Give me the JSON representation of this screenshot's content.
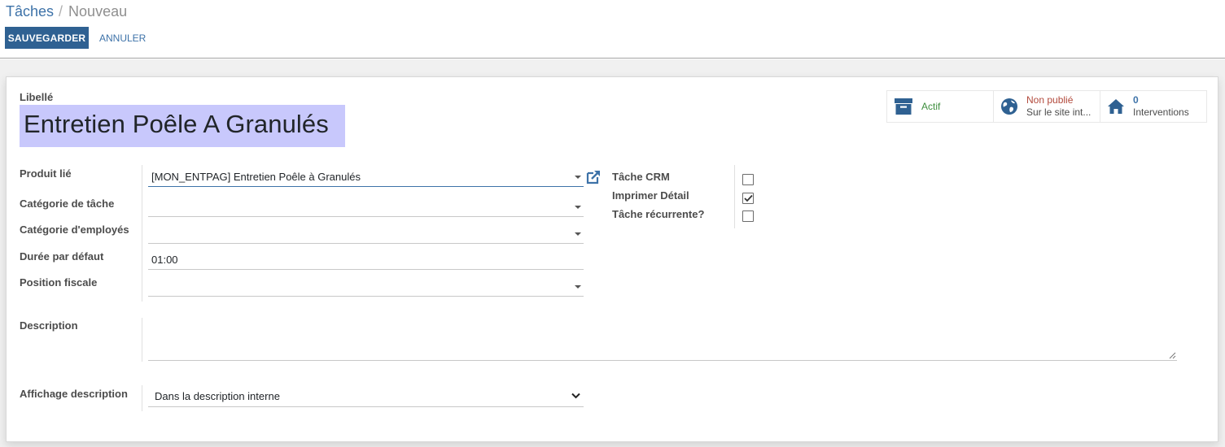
{
  "breadcrumb": {
    "parent": "Tâches",
    "separator": "/",
    "current": "Nouveau"
  },
  "buttons": {
    "save": "SAUVEGARDER",
    "cancel": "ANNULER"
  },
  "title": {
    "label": "Libellé",
    "value": "Entretien Poêle A Granulés"
  },
  "smart_buttons": {
    "active": {
      "label": "Actif",
      "icon": "archive-icon",
      "color": "#3e8e3e"
    },
    "website": {
      "status": "Non publié",
      "sub": "Sur le site int...",
      "icon": "globe-icon",
      "color": "#b24a3c"
    },
    "interventions": {
      "count": "0",
      "label": "Interventions",
      "icon": "home-icon",
      "color": "#3d72a8"
    }
  },
  "fields_left": [
    {
      "label": "Produit lié",
      "value": "[MON_ENTPAG] Entretien Poêle à Granulés",
      "type": "many2one",
      "focused": true
    },
    {
      "label": "Catégorie de tâche",
      "value": "",
      "type": "many2one"
    },
    {
      "label": "Catégorie d'employés",
      "value": "",
      "type": "many2one"
    },
    {
      "label": "Durée par défaut",
      "value": "01:00",
      "type": "time"
    },
    {
      "label": "Position fiscale",
      "value": "",
      "type": "many2one"
    }
  ],
  "fields_right": [
    {
      "label": "Tâche CRM",
      "checked": false
    },
    {
      "label": "Imprimer Détail",
      "checked": true
    },
    {
      "label": "Tâche récurrente?",
      "checked": false
    }
  ],
  "description": {
    "label": "Description",
    "value": ""
  },
  "display_description": {
    "label": "Affichage description",
    "selected": "Dans la description interne"
  },
  "colors": {
    "primary": "#2f6192",
    "link": "#3d72a8",
    "title_highlight": "#c8c8fc"
  }
}
